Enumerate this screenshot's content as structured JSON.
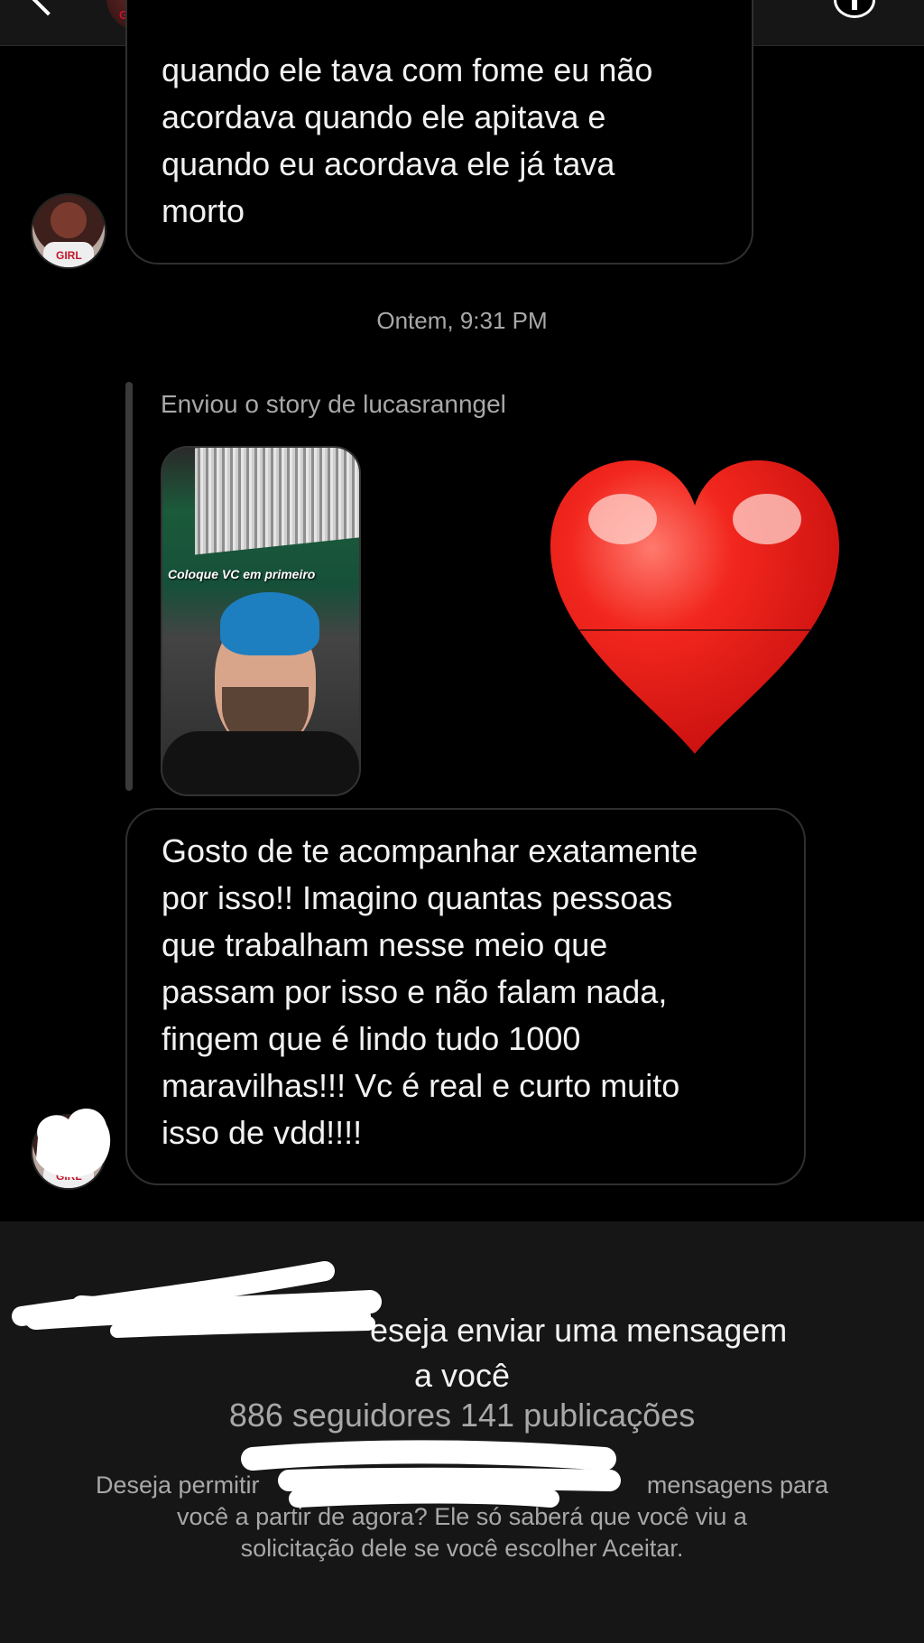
{
  "header": {
    "avatar_badge": "GIRL"
  },
  "messages": [
    {
      "lines": [
        "quando ele tava com fome eu não",
        "acordava quando ele apitava e",
        "quando eu acordava ele já tava",
        "morto"
      ]
    }
  ],
  "timestamp": "Ontem, 9:31 PM",
  "story_reply": {
    "label": "Enviou o story de lucasranngel",
    "caption": "Coloque VC em primeiro",
    "reaction_icon": "heart-emoji"
  },
  "message2": {
    "lines": [
      "Gosto de te acompanhar exatamente",
      "por isso!! Imagino quantas pessoas",
      "que trabalham nesse meio que",
      "passam por isso e não falam nada,",
      "fingem que é lindo tudo 1000",
      "maravilhas!!! Vc é real e curto muito",
      "isso de vdd!!!!"
    ]
  },
  "request": {
    "title_line1": "eseja enviar uma mensagem",
    "title_line2": "a você",
    "stats": "886 seguidores 141 publicações",
    "desc_line1_left": "Deseja permitir",
    "desc_line1_right": "mensagens para",
    "desc_line2": "você a partir de agora? Ele só saberá que você viu a",
    "desc_line3": "solicitação dele se você escolher Aceitar."
  },
  "colors": {
    "background": "#000000",
    "panel": "#161616",
    "bubble_border": "#2f2f2f",
    "muted_text": "#a8a8a8",
    "heart": "#e8221c"
  }
}
